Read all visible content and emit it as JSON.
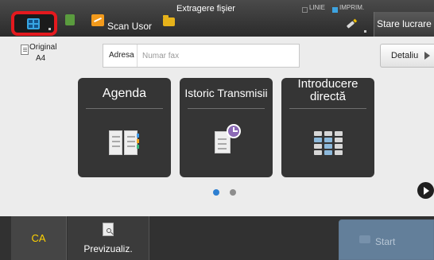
{
  "header": {
    "home_icon": "home-grid-icon",
    "scan_label": "Scan Usor",
    "extract_label": "Extragere fişier",
    "status_line_label": "LINIE",
    "status_print_label": "IMPRIM.",
    "status_job_label": "Stare lucrare",
    "colors": {
      "home_outline": "#e4191e",
      "print_status": "#3da3e0",
      "scan_icon": "#f29a1c",
      "folder_icon": "#e6b21a"
    }
  },
  "address": {
    "original_label": "Original",
    "paper_size": "A4",
    "address_label": "Adresa",
    "fax_placeholder": "Numar fax",
    "detail_label": "Detaliu"
  },
  "tiles": {
    "agenda": {
      "label": "Agenda",
      "icon": "address-book-icon"
    },
    "history": {
      "label": "Istoric Transmisii",
      "icon": "transmission-history-icon"
    },
    "direct": {
      "label": "Introducere directă",
      "icon": "keypad-icon"
    }
  },
  "pager": {
    "current_page": 1,
    "total_pages": 2,
    "active_color": "#2d7fd1"
  },
  "bottom": {
    "ca_label": "CA",
    "preview_label": "Previzualiz.",
    "start_label": "Start",
    "ca_color": "#ffd200",
    "start_color": "#637f9a"
  }
}
